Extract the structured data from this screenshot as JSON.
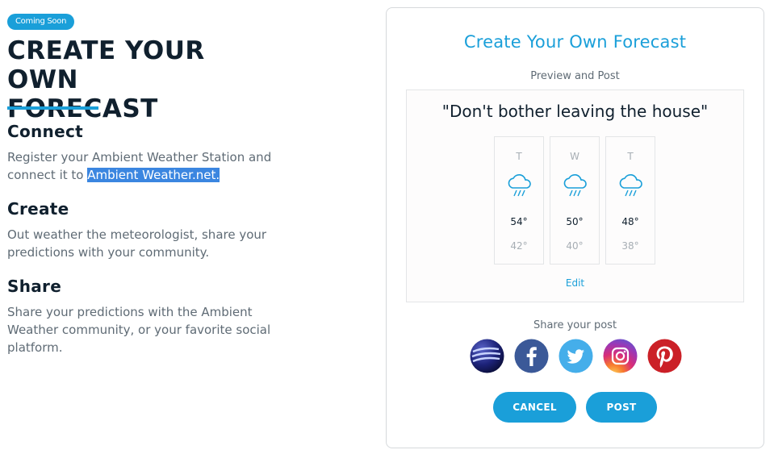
{
  "badge": "Coming Soon",
  "hero": {
    "title_line1": "CREATE YOUR OWN",
    "title_line2": "FORECAST"
  },
  "sections": {
    "connect": {
      "heading": "Connect",
      "body_prefix": "Register your Ambient Weather Station and connect it to ",
      "link": "Ambient Weather.net."
    },
    "create": {
      "heading": "Create",
      "body": "Out weather the meteorologist, share your predictions with your community."
    },
    "share": {
      "heading": "Share",
      "body": "Share your predictions with the Ambient Weather community, or your favorite social platform."
    }
  },
  "card": {
    "title": "Create Your Own Forecast",
    "subtitle": "Preview and Post",
    "quote": "\"Don't bother leaving the house\"",
    "days": [
      {
        "letter": "T",
        "high": "54°",
        "low": "42°",
        "icon": "rain-cloud-icon"
      },
      {
        "letter": "W",
        "high": "50°",
        "low": "40°",
        "icon": "rain-cloud-icon"
      },
      {
        "letter": "T",
        "high": "48°",
        "low": "38°",
        "icon": "rain-cloud-icon"
      }
    ],
    "edit_label": "Edit",
    "share_label": "Share your post",
    "social": [
      "ambient-weather-icon",
      "facebook-icon",
      "twitter-icon",
      "instagram-icon",
      "pinterest-icon"
    ],
    "cancel_label": "CANCEL",
    "post_label": "POST"
  },
  "colors": {
    "accent": "#1a9fd9",
    "heading": "#10202e",
    "body": "#5f6b75",
    "facebook": "#3b5998",
    "twitter": "#45aeea",
    "pinterest": "#cb2027"
  }
}
